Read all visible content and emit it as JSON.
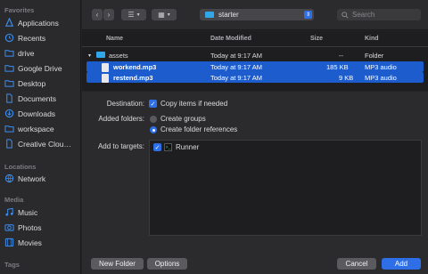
{
  "sidebar": {
    "sections": {
      "favorites": "Favorites",
      "locations": "Locations",
      "media": "Media",
      "tags": "Tags"
    },
    "favorites": [
      {
        "label": "Applications",
        "icon": "applications-icon"
      },
      {
        "label": "Recents",
        "icon": "clock-icon"
      },
      {
        "label": "drive",
        "icon": "folder-icon"
      },
      {
        "label": "Google Drive",
        "icon": "folder-icon"
      },
      {
        "label": "Desktop",
        "icon": "folder-icon"
      },
      {
        "label": "Documents",
        "icon": "document-icon"
      },
      {
        "label": "Downloads",
        "icon": "download-icon"
      },
      {
        "label": "workspace",
        "icon": "folder-icon"
      },
      {
        "label": "Creative Clou…",
        "icon": "document-icon"
      }
    ],
    "locations": [
      {
        "label": "Network",
        "icon": "globe-icon"
      }
    ],
    "media": [
      {
        "label": "Music",
        "icon": "music-icon"
      },
      {
        "label": "Photos",
        "icon": "camera-icon"
      },
      {
        "label": "Movies",
        "icon": "film-icon"
      }
    ]
  },
  "toolbar": {
    "back": "‹",
    "forward": "›",
    "list_view": "☰",
    "grid_view": "▦",
    "path": "starter",
    "search_placeholder": "Search"
  },
  "file_list": {
    "headers": {
      "name": "Name",
      "date": "Date Modified",
      "size": "Size",
      "kind": "Kind"
    },
    "rows": [
      {
        "name": "assets",
        "date": "Today at 9:17 AM",
        "size": "--",
        "kind": "Folder",
        "selected": false,
        "type": "folder"
      },
      {
        "name": "workend.mp3",
        "date": "Today at 9:17 AM",
        "size": "185 KB",
        "kind": "MP3 audio",
        "selected": true,
        "type": "file"
      },
      {
        "name": "restend.mp3",
        "date": "Today at 9:17 AM",
        "size": "9 KB",
        "kind": "MP3 audio",
        "selected": true,
        "type": "file"
      }
    ]
  },
  "options": {
    "destination_label": "Destination:",
    "copy_items": "Copy items if needed",
    "added_folders_label": "Added folders:",
    "create_groups": "Create groups",
    "create_folder_refs": "Create folder references",
    "add_to_targets_label": "Add to targets:",
    "target_name": "Runner"
  },
  "buttons": {
    "new_folder": "New Folder",
    "options": "Options",
    "cancel": "Cancel",
    "add": "Add"
  },
  "colors": {
    "accent": "#2e6fe8",
    "selection": "#1c5ccc",
    "folder": "#2fa7e8"
  }
}
